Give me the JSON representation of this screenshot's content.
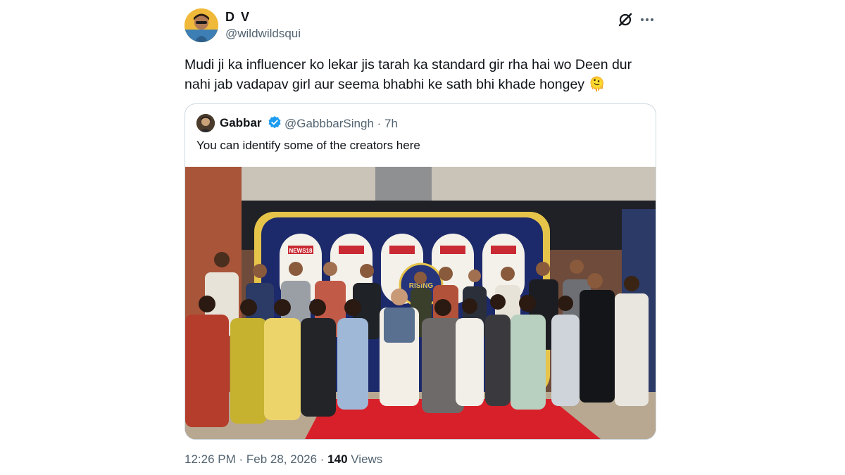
{
  "tweet": {
    "display_name": "D V",
    "handle": "@wildwildsqui",
    "text": "Mudi ji ka influencer ko lekar jis tarah ka standard gir rha hai wo Deen dur nahi jab vadapav girl aur seema bhabhi ke sath bhi khade hongey 🫠",
    "timestamp": "12:26 PM · Feb 28, 2026 · ",
    "views_count": "140",
    "views_label": " Views"
  },
  "quoted": {
    "display_name": "Gabbar",
    "handle_time": "@GabbbarSingh · 7h",
    "text": "You can identify some of the creators here",
    "photo_backdrop_text": "NEWS18",
    "photo_center_text": "RISING"
  },
  "icons": {
    "grok": "grok-icon",
    "more": "more-icon",
    "verified": "verified-badge-icon"
  },
  "colors": {
    "secondary_text": "#536471",
    "verified_blue": "#1d9bf0",
    "border": "#cfd9de",
    "carpet_red": "#d8202a"
  }
}
